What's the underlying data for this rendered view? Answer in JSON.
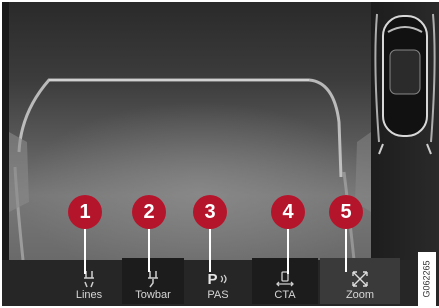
{
  "toolbar": {
    "buttons": [
      {
        "label": "Lines",
        "icon": "lines-icon",
        "callout": "1"
      },
      {
        "label": "Towbar",
        "icon": "towbar-icon",
        "callout": "2"
      },
      {
        "label": "PAS",
        "icon": "pas-icon",
        "callout": "3",
        "icon_text": "P"
      },
      {
        "label": "CTA",
        "icon": "cta-icon",
        "callout": "4"
      },
      {
        "label": "Zoom",
        "icon": "zoom-icon",
        "callout": "5"
      }
    ]
  },
  "figure_id": "G062265",
  "colors": {
    "callout": "#b5152b",
    "toolbar": "#262626"
  }
}
